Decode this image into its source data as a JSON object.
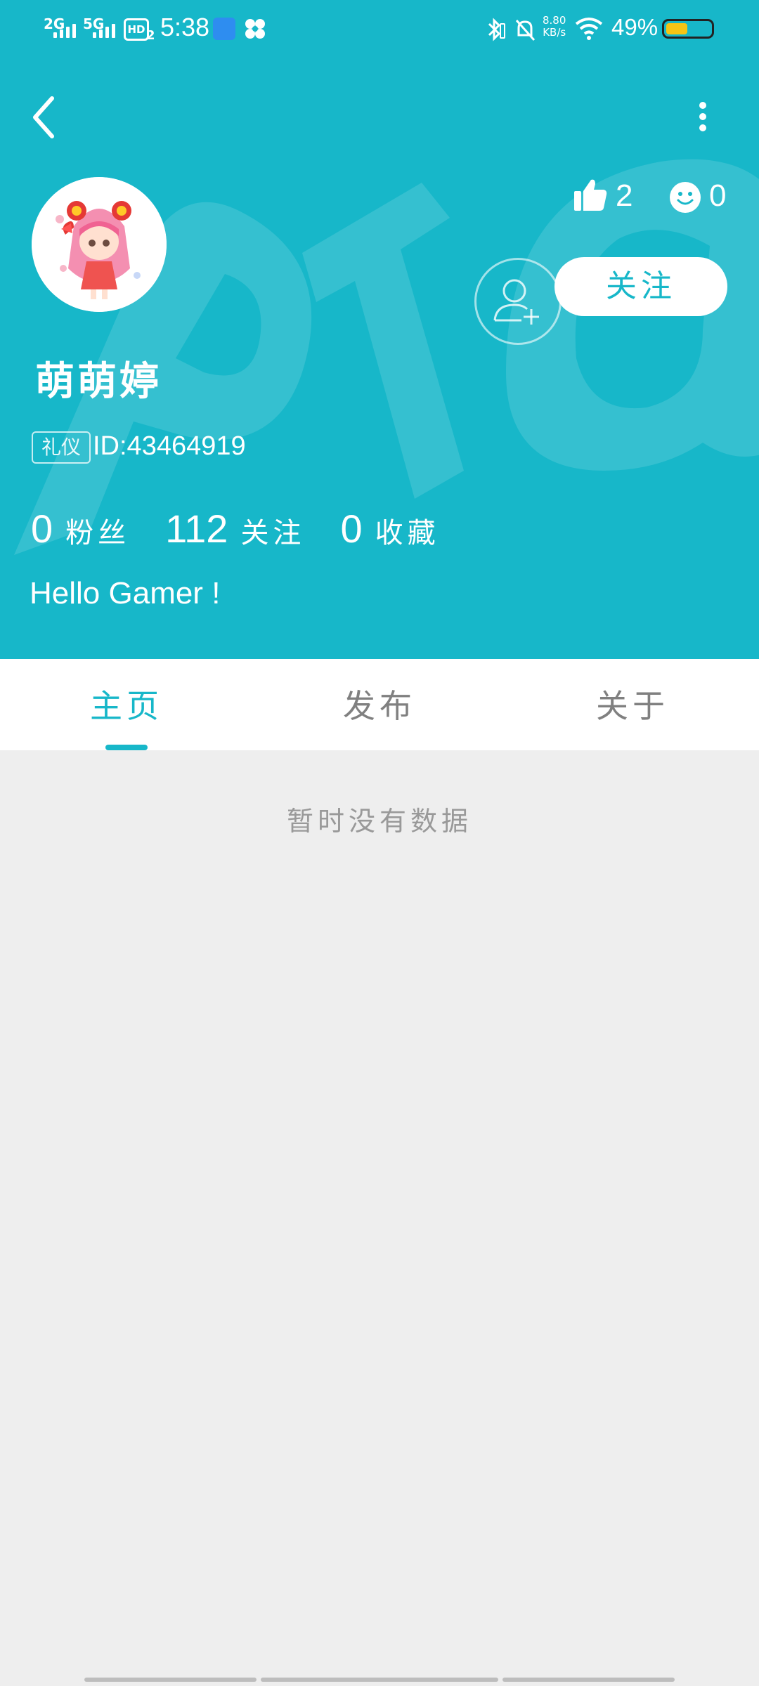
{
  "status_bar": {
    "sim1": "2G",
    "sim2": "5G",
    "hd_label": "HD",
    "hd_sub": "2",
    "time": "5:38",
    "net_speed": "8.80",
    "net_unit": "KB/s",
    "battery_pct": "49%",
    "battery_level": 0.49,
    "icons": [
      "bluetooth-icon",
      "mute-bell-icon",
      "wifi-icon"
    ]
  },
  "colors": {
    "primary": "#17b7c9",
    "background": "#eeeeee",
    "white": "#ffffff",
    "muted_text": "#999999"
  },
  "header": {
    "likes": "2",
    "smiles": "0",
    "follow_label": "关注",
    "username": "萌萌婷",
    "tag": "礼仪",
    "user_id": "ID:43464919",
    "fans_count": "0",
    "fans_label": "粉丝",
    "following_count": "112",
    "following_label": "关注",
    "favorites_count": "0",
    "favorites_label": "收藏",
    "bio": "Hello Gamer !"
  },
  "tabs": [
    {
      "label": "主页",
      "active": true
    },
    {
      "label": "发布",
      "active": false
    },
    {
      "label": "关于",
      "active": false
    }
  ],
  "content": {
    "empty_text": "暂时没有数据"
  }
}
